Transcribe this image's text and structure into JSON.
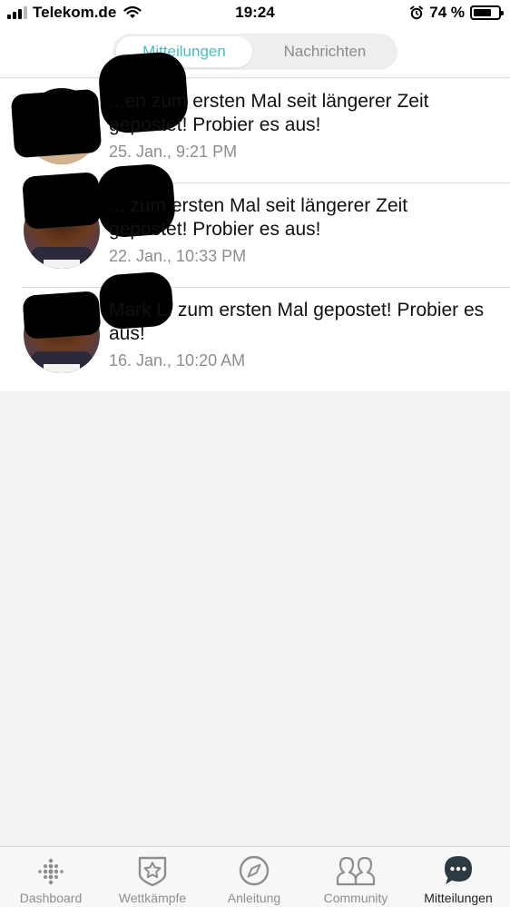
{
  "status_bar": {
    "carrier": "Telekom.de",
    "time": "19:24",
    "battery": "74 %",
    "battery_level": 0.74
  },
  "segment": {
    "active_label": "Mitteilungen",
    "inactive_label": "Nachrichten"
  },
  "notifications": [
    {
      "message": "hat ... zum ersten Mal seit längerer Zeit gepostet! Probier es aus!",
      "visible_message": "...en zum ersten Mal seit längerer Zeit gepostet! Probier es aus!",
      "time": "25. Jan., 9:21 PM"
    },
    {
      "visible_message": "... zum ersten Mal seit längerer Zeit gepostet! Probier es aus!",
      "time": "22. Jan., 10:33 PM"
    },
    {
      "visible_message": "Mark L. zum ersten Mal gepostet! Probier es aus!",
      "time": "16. Jan., 10:20 AM"
    }
  ],
  "tabbar": {
    "tabs": [
      {
        "label": "Dashboard",
        "icon": "dots-grid-icon"
      },
      {
        "label": "Wettkämpfe",
        "icon": "star-badge-icon"
      },
      {
        "label": "Anleitung",
        "icon": "compass-icon"
      },
      {
        "label": "Community",
        "icon": "people-icon"
      },
      {
        "label": "Mitteilungen",
        "icon": "chat-bubble-icon"
      }
    ]
  },
  "colors": {
    "accent": "#4bbfc0",
    "inactive": "#8e8e8e",
    "background": "#f2f2f2"
  }
}
